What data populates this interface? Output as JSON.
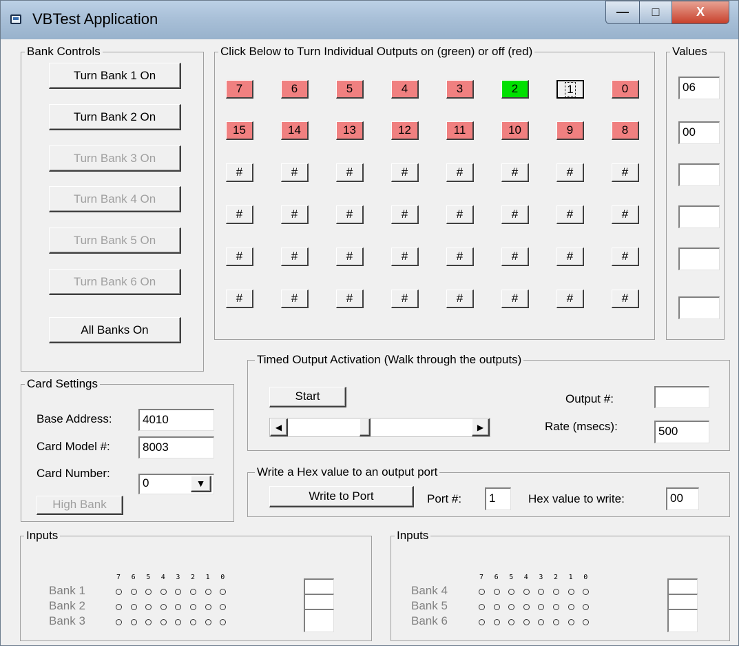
{
  "window": {
    "title": "VBTest Application",
    "min_glyph": "—",
    "max_glyph": "□",
    "close_glyph": "X"
  },
  "bank_controls": {
    "title": "Bank Controls",
    "buttons": [
      {
        "label": "Turn Bank 1 On",
        "enabled": true
      },
      {
        "label": "Turn Bank 2 On",
        "enabled": true
      },
      {
        "label": "Turn Bank 3 On",
        "enabled": false
      },
      {
        "label": "Turn Bank 4 On",
        "enabled": false
      },
      {
        "label": "Turn Bank 5 On",
        "enabled": false
      },
      {
        "label": "Turn Bank 6 On",
        "enabled": false
      },
      {
        "label": "All Banks On",
        "enabled": true
      }
    ]
  },
  "outputs": {
    "title": "Click Below to Turn Individual Outputs on (green) or off (red)",
    "rows": [
      [
        {
          "label": "7",
          "state": "red"
        },
        {
          "label": "6",
          "state": "red"
        },
        {
          "label": "5",
          "state": "red"
        },
        {
          "label": "4",
          "state": "red"
        },
        {
          "label": "3",
          "state": "red"
        },
        {
          "label": "2",
          "state": "green"
        },
        {
          "label": "1",
          "state": "focused"
        },
        {
          "label": "0",
          "state": "red"
        }
      ],
      [
        {
          "label": "15",
          "state": "red"
        },
        {
          "label": "14",
          "state": "red"
        },
        {
          "label": "13",
          "state": "red"
        },
        {
          "label": "12",
          "state": "red"
        },
        {
          "label": "11",
          "state": "red"
        },
        {
          "label": "10",
          "state": "red"
        },
        {
          "label": "9",
          "state": "red"
        },
        {
          "label": "8",
          "state": "red"
        }
      ],
      [
        {
          "label": "#",
          "state": "grey"
        },
        {
          "label": "#",
          "state": "grey"
        },
        {
          "label": "#",
          "state": "grey"
        },
        {
          "label": "#",
          "state": "grey"
        },
        {
          "label": "#",
          "state": "grey"
        },
        {
          "label": "#",
          "state": "grey"
        },
        {
          "label": "#",
          "state": "grey"
        },
        {
          "label": "#",
          "state": "grey"
        }
      ],
      [
        {
          "label": "#",
          "state": "grey"
        },
        {
          "label": "#",
          "state": "grey"
        },
        {
          "label": "#",
          "state": "grey"
        },
        {
          "label": "#",
          "state": "grey"
        },
        {
          "label": "#",
          "state": "grey"
        },
        {
          "label": "#",
          "state": "grey"
        },
        {
          "label": "#",
          "state": "grey"
        },
        {
          "label": "#",
          "state": "grey"
        }
      ],
      [
        {
          "label": "#",
          "state": "grey"
        },
        {
          "label": "#",
          "state": "grey"
        },
        {
          "label": "#",
          "state": "grey"
        },
        {
          "label": "#",
          "state": "grey"
        },
        {
          "label": "#",
          "state": "grey"
        },
        {
          "label": "#",
          "state": "grey"
        },
        {
          "label": "#",
          "state": "grey"
        },
        {
          "label": "#",
          "state": "grey"
        }
      ],
      [
        {
          "label": "#",
          "state": "grey"
        },
        {
          "label": "#",
          "state": "grey"
        },
        {
          "label": "#",
          "state": "grey"
        },
        {
          "label": "#",
          "state": "grey"
        },
        {
          "label": "#",
          "state": "grey"
        },
        {
          "label": "#",
          "state": "grey"
        },
        {
          "label": "#",
          "state": "grey"
        },
        {
          "label": "#",
          "state": "grey"
        }
      ]
    ]
  },
  "values": {
    "title": "Values",
    "items": [
      "06",
      "00",
      "",
      "",
      "",
      ""
    ]
  },
  "card_settings": {
    "title": "Card Settings",
    "base_address_label": "Base Address:",
    "base_address": "4010",
    "card_model_label": "Card Model #:",
    "card_model": "8003",
    "card_number_label": "Card Number:",
    "card_number": "0",
    "high_bank_label": "High Bank"
  },
  "timed": {
    "title": "Timed Output Activation  (Walk through the outputs)",
    "start_label": "Start",
    "output_label": "Output #:",
    "output_value": "",
    "rate_label": "Rate (msecs):",
    "rate_value": "500",
    "slider_position": 0.41
  },
  "hex_write": {
    "title": "Write a Hex value to an output port",
    "button_label": "Write to Port",
    "port_label": "Port #:",
    "port_value": "1",
    "hex_label": "Hex value to write:",
    "hex_value": "00"
  },
  "inputs_left": {
    "title": "Inputs",
    "bits": [
      "7",
      "6",
      "5",
      "4",
      "3",
      "2",
      "1",
      "0"
    ],
    "banks": [
      {
        "label": "Bank 1",
        "value": ""
      },
      {
        "label": "Bank 2",
        "value": ""
      },
      {
        "label": "Bank 3",
        "value": ""
      }
    ]
  },
  "inputs_right": {
    "title": "Inputs",
    "bits": [
      "7",
      "6",
      "5",
      "4",
      "3",
      "2",
      "1",
      "0"
    ],
    "banks": [
      {
        "label": "Bank 4",
        "value": ""
      },
      {
        "label": "Bank 5",
        "value": ""
      },
      {
        "label": "Bank 6",
        "value": ""
      }
    ]
  },
  "colors": {
    "on": "#00e000",
    "off": "#f08080",
    "face": "#f0f0f0"
  }
}
